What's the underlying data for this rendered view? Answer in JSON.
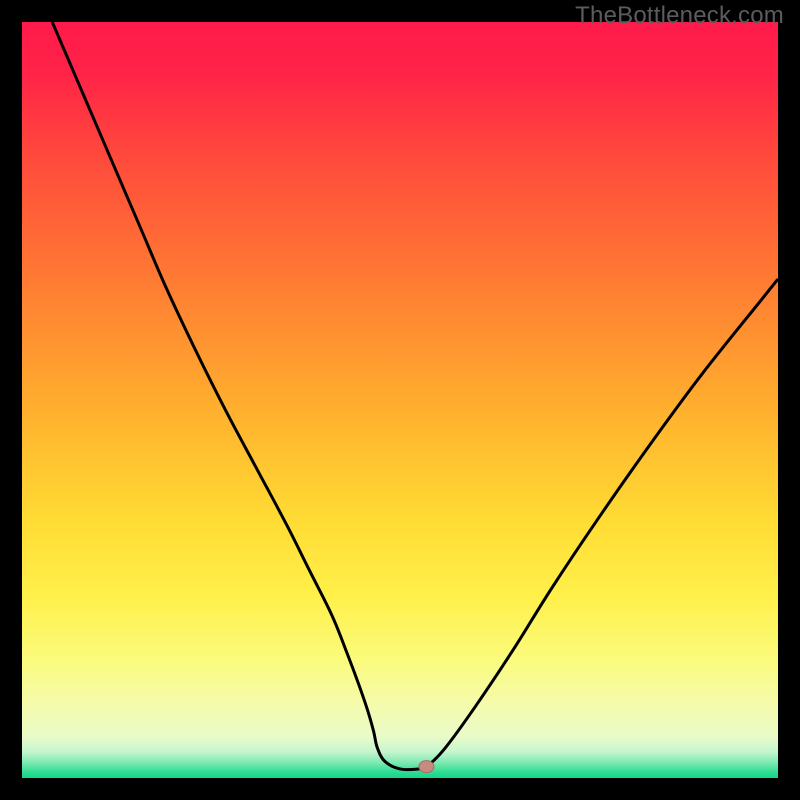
{
  "watermark": "TheBottleneck.com",
  "colors": {
    "frame": "#000000",
    "watermark": "#5c5c5c",
    "curve": "#000000",
    "marker_fill": "#c98a7f",
    "marker_stroke": "#a86a5f",
    "gradient_stops": [
      {
        "offset": 0.0,
        "color": "#ff1a4b"
      },
      {
        "offset": 0.07,
        "color": "#ff2447"
      },
      {
        "offset": 0.18,
        "color": "#ff4a3c"
      },
      {
        "offset": 0.3,
        "color": "#ff6e35"
      },
      {
        "offset": 0.42,
        "color": "#ff9330"
      },
      {
        "offset": 0.54,
        "color": "#ffb82e"
      },
      {
        "offset": 0.66,
        "color": "#ffdc34"
      },
      {
        "offset": 0.76,
        "color": "#fff04a"
      },
      {
        "offset": 0.84,
        "color": "#fbfb7a"
      },
      {
        "offset": 0.9,
        "color": "#f5fbaa"
      },
      {
        "offset": 0.945,
        "color": "#e9fbc8"
      },
      {
        "offset": 0.965,
        "color": "#c7f6cf"
      },
      {
        "offset": 0.98,
        "color": "#7be9b0"
      },
      {
        "offset": 0.992,
        "color": "#2fdd95"
      },
      {
        "offset": 1.0,
        "color": "#14d786"
      }
    ]
  },
  "chart_data": {
    "type": "line",
    "title": "",
    "xlabel": "",
    "ylabel": "",
    "xlim": [
      0,
      100
    ],
    "ylim": [
      0,
      100
    ],
    "grid": false,
    "legend": false,
    "annotations": [
      "TheBottleneck.com"
    ],
    "series": [
      {
        "name": "bottleneck-curve",
        "x": [
          4,
          7,
          10,
          13,
          16,
          19,
          23,
          27,
          31,
          35,
          38,
          41,
          43,
          44.5,
          45.7,
          46.5,
          47,
          48,
          50,
          52.5,
          53.5,
          56,
          60,
          65,
          70,
          76,
          83,
          90,
          98,
          100
        ],
        "y": [
          100,
          93,
          86,
          79,
          72,
          65,
          56.5,
          48.5,
          41,
          33.5,
          27.5,
          21.5,
          16.5,
          12.5,
          9,
          6.2,
          4,
          2.2,
          1.2,
          1.2,
          1.5,
          4,
          9.5,
          17,
          25,
          34,
          44,
          53.5,
          63.5,
          66
        ]
      }
    ],
    "marker": {
      "x": 53.5,
      "y": 1.5
    },
    "background": "vertical-gradient red→orange→yellow→green"
  }
}
